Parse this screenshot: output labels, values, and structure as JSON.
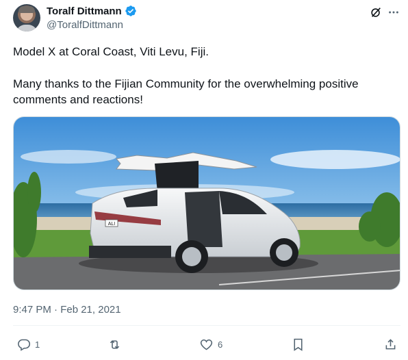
{
  "author": {
    "name": "Toralf Dittmann",
    "handle": "@ToralfDittmann",
    "verified": true
  },
  "tweet": {
    "line1": "Model X at Coral Coast, Viti Levu, Fiji.",
    "line2": "Many thanks to the Fijian Community for the overwhelming positive",
    "line3": "comments and reactions!"
  },
  "media": {
    "plate": "ALI"
  },
  "timestamp": "9:47 PM · Feb 21, 2021",
  "actions": {
    "reply_count": "1",
    "retweet_count": "",
    "like_count": "6"
  },
  "colors": {
    "verified": "#1d9bf0",
    "text": "#0f1419",
    "secondary": "#536471"
  },
  "icons": {
    "top": [
      "grok-icon",
      "more-icon"
    ],
    "actions": [
      "reply-icon",
      "retweet-icon",
      "like-icon",
      "bookmark-icon",
      "share-icon"
    ]
  }
}
